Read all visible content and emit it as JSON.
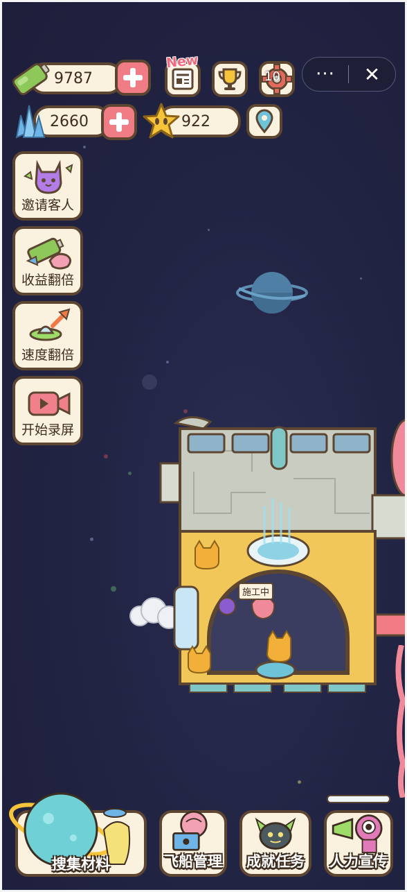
{
  "resources": {
    "energy": {
      "value": "9787",
      "icon": "battery-icon"
    },
    "crystal": {
      "value": "2660",
      "icon": "crystal-icon"
    },
    "star": {
      "value": "922",
      "icon": "star-face-icon"
    }
  },
  "top_buttons": {
    "news_badge": "New",
    "settings_badge": "10",
    "icons": [
      "news-icon",
      "trophy-icon",
      "gear-icon",
      "location-pin-icon"
    ]
  },
  "capsule": {
    "more": "···",
    "close": "✕"
  },
  "side_menu": [
    {
      "label": "邀请客人",
      "icon": "purple-cat-icon"
    },
    {
      "label": "收益翻倍",
      "icon": "battery-pig-icon"
    },
    {
      "label": "速度翻倍",
      "icon": "ufo-arrow-icon"
    },
    {
      "label": "开始录屏",
      "icon": "video-camera-icon"
    }
  ],
  "ship": {
    "status_label": "施工中"
  },
  "bottom_menu": [
    {
      "label": "搜集材料",
      "icon": "planet-icon"
    },
    {
      "label": "飞船管理",
      "icon": "laptop-brain-icon"
    },
    {
      "label": "成就任务",
      "icon": "robot-bee-icon"
    },
    {
      "label": "人力宣传",
      "icon": "megaphone-creature-icon"
    }
  ],
  "colors": {
    "background": "#222444",
    "panel": "#fbf1df",
    "border": "#5c4632",
    "plus": "#f07d86",
    "ship_floor": "#f2c75a",
    "ship_roof": "#c9ccc0"
  }
}
